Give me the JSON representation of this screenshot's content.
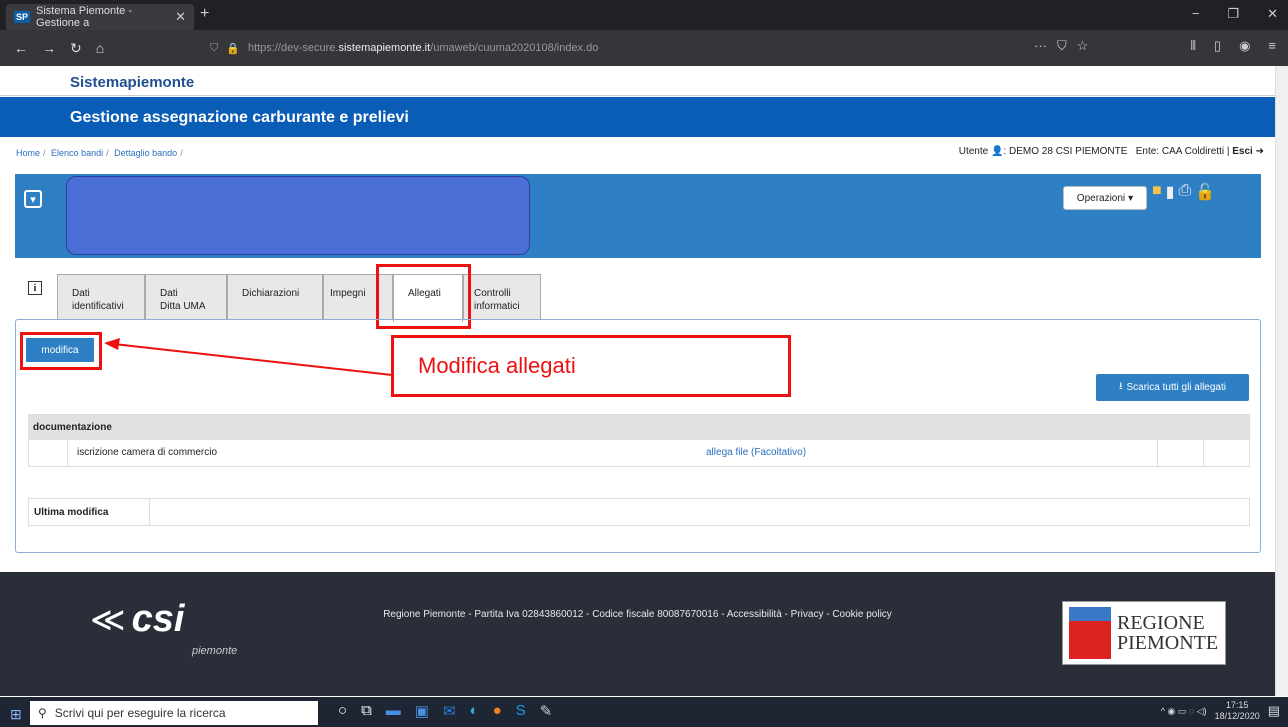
{
  "browser": {
    "tab_title": "Sistema Piemonte - Gestione a",
    "tab_badge": "SP",
    "url_prefix": "https://dev-secure.",
    "url_domain": "sistemapiemonte.it",
    "url_path": "/umaweb/cuuma2020108/index.do"
  },
  "site": {
    "name": "Sistemapiemonte",
    "title": "Gestione assegnazione carburante e prelievi"
  },
  "breadcrumb": [
    "Home",
    "Elenco bandi",
    "Dettaglio bando"
  ],
  "user": {
    "label": "Utente",
    "name": "DEMO 28 CSI PIEMONTE",
    "ente": "Ente: CAA Coldiretti",
    "logout": "Esci"
  },
  "toolbar": {
    "operations_label": "Operazioni"
  },
  "tabs": [
    {
      "label1": "Dati",
      "label2": "identificativi"
    },
    {
      "label1": "Dati",
      "label2": "Ditta UMA"
    },
    {
      "label1": "Dichiarazioni",
      "label2": ""
    },
    {
      "label1": "Impegni",
      "label2": ""
    },
    {
      "label1": "Allegati",
      "label2": ""
    },
    {
      "label1": "Controlli",
      "label2": "informatici"
    }
  ],
  "content": {
    "modify_button": "modifica",
    "callout": "Modifica allegati",
    "download_all": "Scarica tutti gli allegati",
    "doc_section": "documentazione",
    "doc_item": "iscrizione camera di commercio",
    "doc_action": "allega file (Facoltativo)",
    "last_modified_label": "Ultima modifica"
  },
  "footer": {
    "text": "Regione Piemonte - Partita Iva 02843860012 - Codice fiscale 80087670016 - Accessibilità - Privacy - Cookie policy",
    "csi": "csi",
    "csi_sub": "piemonte",
    "regione_line1": "REGIONE",
    "regione_line2": "PIEMONTE"
  },
  "taskbar": {
    "search_placeholder": "Scrivi qui per eseguire la ricerca",
    "time": "17:15",
    "date": "18/12/2020"
  },
  "colors": {
    "header_blue": "#0a5db6",
    "panel_blue": "#2e7fc4",
    "highlight_red": "#e11111"
  }
}
